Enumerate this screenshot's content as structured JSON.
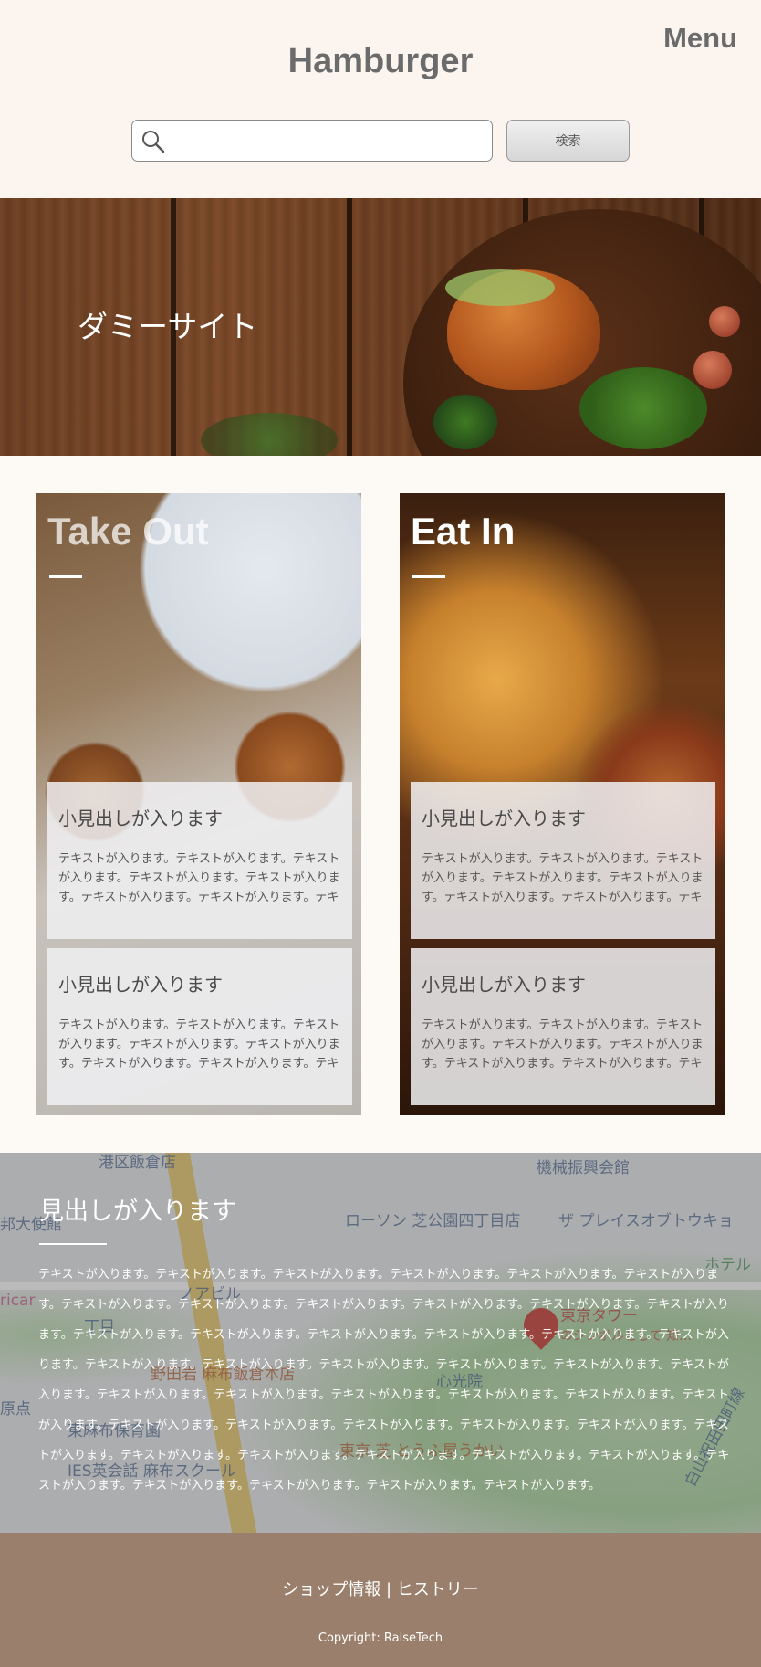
{
  "header": {
    "logo": "Hamburger",
    "menu_label": "Menu",
    "search_placeholder": "",
    "search_button": "検索"
  },
  "hero": {
    "title": "ダミーサイト"
  },
  "cards": [
    {
      "title": "Take Out",
      "items": [
        {
          "heading": "小見出しが入ります",
          "text": "テキストが入ります。テキストが入ります。テキストが入ります。テキストが入ります。テキストが入ります。テキストが入ります。テキストが入ります。テキス"
        },
        {
          "heading": "小見出しが入ります",
          "text": "テキストが入ります。テキストが入ります。テキストが入ります。テキストが入ります。テキストが入ります。テキストが入ります。テキストが入ります。テキス"
        }
      ]
    },
    {
      "title": "Eat In",
      "items": [
        {
          "heading": "小見出しが入ります",
          "text": "テキストが入ります。テキストが入ります。テキストが入ります。テキストが入ります。テキストが入ります。テキストが入ります。テキストが入ります。テキス"
        },
        {
          "heading": "小見出しが入ります",
          "text": "テキストが入ります。テキストが入ります。テキストが入ります。テキストが入ります。テキストが入ります。テキストが入ります。テキストが入ります。テキス"
        }
      ]
    }
  ],
  "map_section": {
    "heading": "見出しが入ります",
    "text": "テキストが入ります。テキストが入ります。テキストが入ります。テキストが入ります。テキストが入ります。テキストが入ります。テキストが入ります。テキストが入ります。テキストが入ります。テキストが入ります。テキストが入ります。テキストが入ります。テキストが入ります。テキストが入ります。テキストが入ります。テキストが入ります。テキストが入ります。テキストが入ります。テキストが入ります。テキストが入ります。テキストが入ります。テキストが入ります。テキストが入ります。テキストが入ります。テキストが入ります。テキストが入ります。テキストが入ります。テキストが入ります。テキストが入ります。テキストが入ります。テキストが入ります。テキストが入ります。テキストが入ります。テキストが入ります。テキストが入ります。テキストが入ります。テキストが入ります。テキストが入ります。テキストが入ります。テキストが入ります。テキストが入ります。テキストが入ります。テキストが入ります。テキストが入ります。テキストが入ります。テキストが入ります。",
    "map_labels": [
      "港区飯倉店",
      "機械振興会館",
      "ローソン 芝公園四丁目店",
      "ザ プレイスオブトウキョ",
      "東京タワー",
      "のシンボルとして 知…",
      "野田岩 麻布飯倉本店",
      "心光院",
      "東京 芝 とうふ屋うかい",
      "東麻布保育園",
      "IES英会話 麻布スクール",
      "白山祝田田町線",
      "邦大使館",
      "ricar",
      "ノアビル",
      "丁目",
      "原点",
      "ホテル"
    ]
  },
  "footer": {
    "shop_info": "ショップ情報",
    "separator": " | ",
    "history": "ヒストリー",
    "copyright": "Copyright: RaiseTech"
  }
}
